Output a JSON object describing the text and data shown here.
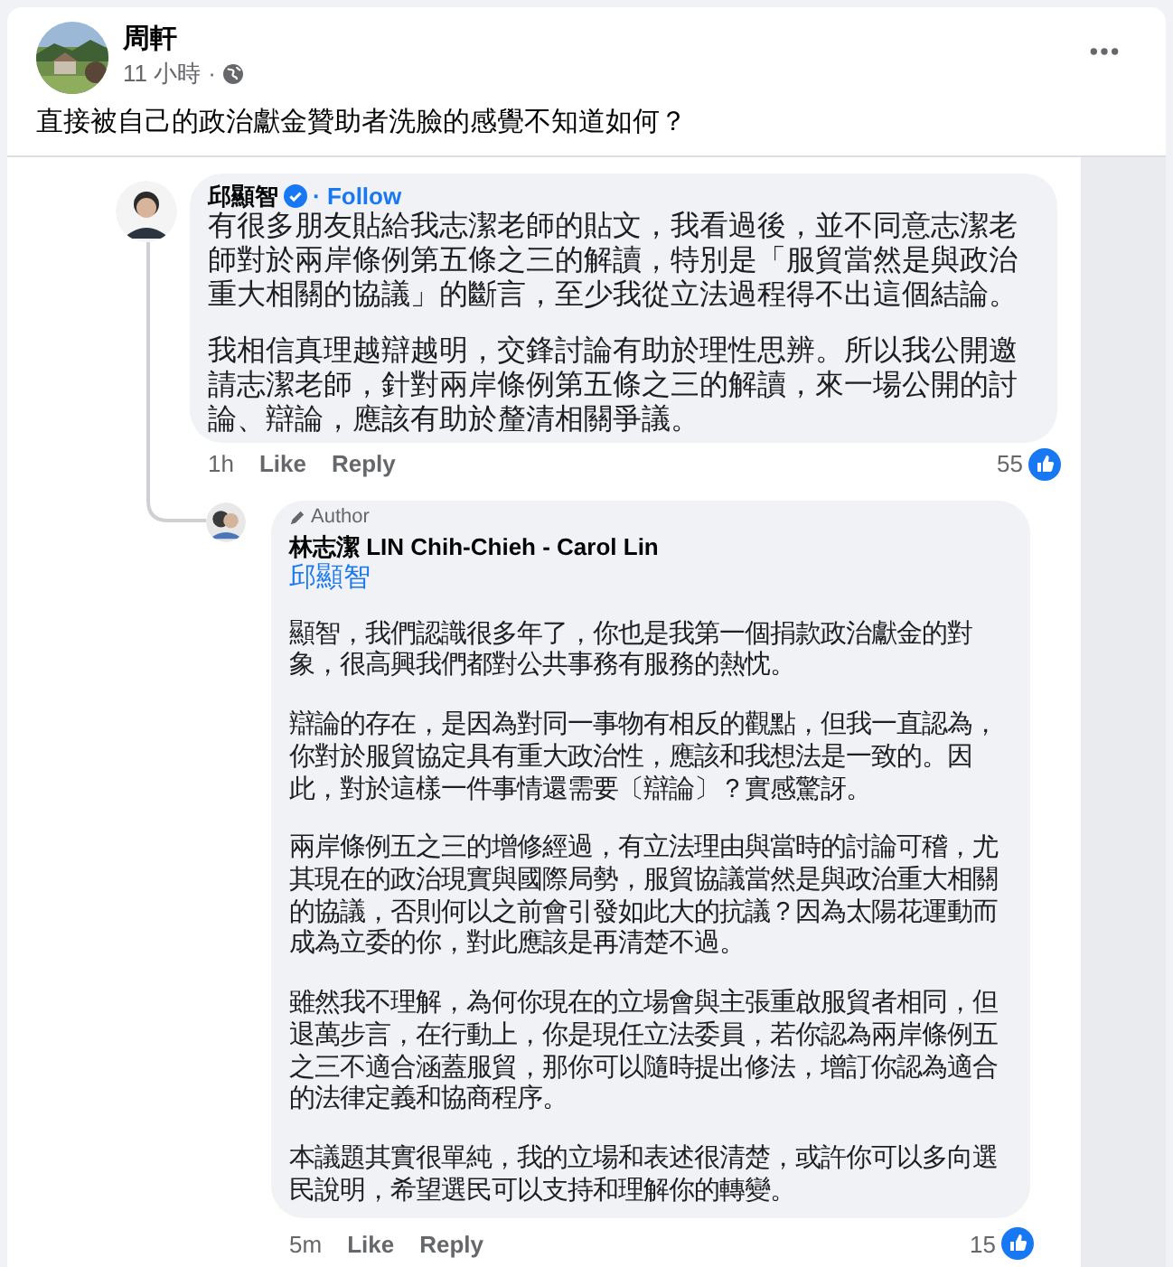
{
  "post": {
    "author": "周軒",
    "time": "11 小時",
    "separator": "·",
    "text": "直接被自己的政治獻金贊助者洗臉的感覺不知道如何？"
  },
  "image": {
    "comment": {
      "author": "邱顯智",
      "verified": true,
      "follow": "· Follow",
      "paragraphs": [
        "有很多朋友貼給我志潔老師的貼文，我看過後，並不同意志潔老師對於兩岸條例第五條之三的解讀，特別是「服貿當然是與政治重大相關的協議」的斷言，至少我從立法過程得不出這個結論。",
        "我相信真理越辯越明，交鋒討論有助於理性思辨。所以我公開邀請志潔老師，針對兩岸條例第五條之三的解讀，來一場公開的討論、辯論，應該有助於釐清相關爭議。"
      ],
      "age": "1h",
      "like": "Like",
      "reply": "Reply",
      "reactions": "55"
    },
    "reply": {
      "badge": "Author",
      "author": "林志潔 LIN Chih-Chieh - Carol Lin",
      "mention": "邱顯智",
      "paragraphs": [
        "顯智，我們認識很多年了，你也是我第一個捐款政治獻金的對象，很高興我們都對公共事務有服務的熱忱。",
        "辯論的存在，是因為對同一事物有相反的觀點，但我一直認為，你對於服貿協定具有重大政治性，應該和我想法是一致的。因此，對於這樣一件事情還需要〔辯論〕？實感驚訝。",
        "兩岸條例五之三的增修經過，有立法理由與當時的討論可稽，尤其現在的政治現實與國際局勢，服貿協議當然是與政治重大相關的協議，否則何以之前會引發如此大的抗議？因為太陽花運動而成為立委的你，對此應該是再清楚不過。",
        "雖然我不理解，為何你現在的立場會與主張重啟服貿者相同，但退萬步言，在行動上，你是現任立法委員，若你認為兩岸條例五之三不適合涵蓋服貿，那你可以隨時提出修法，增訂你認為適合的法律定義和協商程序。",
        "本議題其實很單純，我的立場和表述很清楚，或許你可以多向選民說明，希望選民可以支持和理解你的轉變。"
      ],
      "age": "5m",
      "like": "Like",
      "reply": "Reply",
      "reactions": "15"
    }
  }
}
